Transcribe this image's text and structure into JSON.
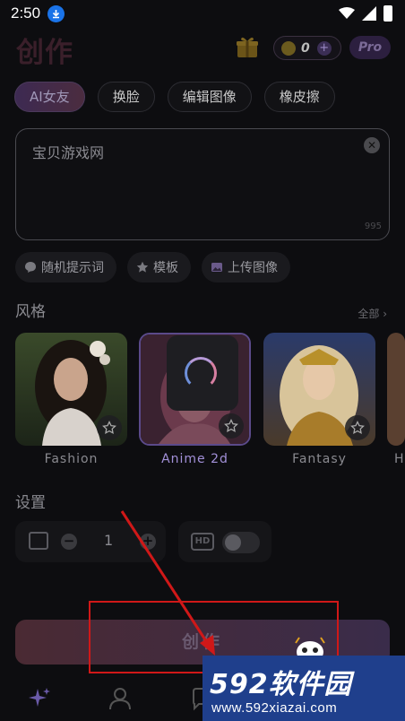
{
  "status_bar": {
    "time": "2:50"
  },
  "header": {
    "title": "创作",
    "coins": "0",
    "pro_label": "Pro"
  },
  "tabs": [
    {
      "label": "AI女友",
      "active": true
    },
    {
      "label": "换脸",
      "active": false
    },
    {
      "label": "编辑图像",
      "active": false
    },
    {
      "label": "橡皮擦",
      "active": false
    }
  ],
  "prompt": {
    "value": "宝贝游戏网",
    "char_count": "995"
  },
  "chips": [
    {
      "label": "随机提示词",
      "icon": "chat-bubble-icon"
    },
    {
      "label": "模板",
      "icon": "star-icon"
    },
    {
      "label": "上传图像",
      "icon": "image-icon"
    }
  ],
  "styles": {
    "title": "风格",
    "see_all": "全部 ›",
    "items": [
      {
        "name": "Fashion",
        "selected": false
      },
      {
        "name": "Anime 2d",
        "selected": true
      },
      {
        "name": "Fantasy",
        "selected": false
      },
      {
        "name": "H",
        "selected": false
      }
    ]
  },
  "settings": {
    "title": "设置",
    "image_count": "1",
    "hd_label": "HD",
    "hd_enabled": false
  },
  "create_button": {
    "label": "创作"
  },
  "watermark": {
    "logo": "592软件园",
    "url": "www.592xiazai.com"
  },
  "colors": {
    "background": "#0d0d10",
    "accent": "#5b4a8a",
    "annotation": "#d01818",
    "watermark_bg": "#1f3f8c"
  }
}
